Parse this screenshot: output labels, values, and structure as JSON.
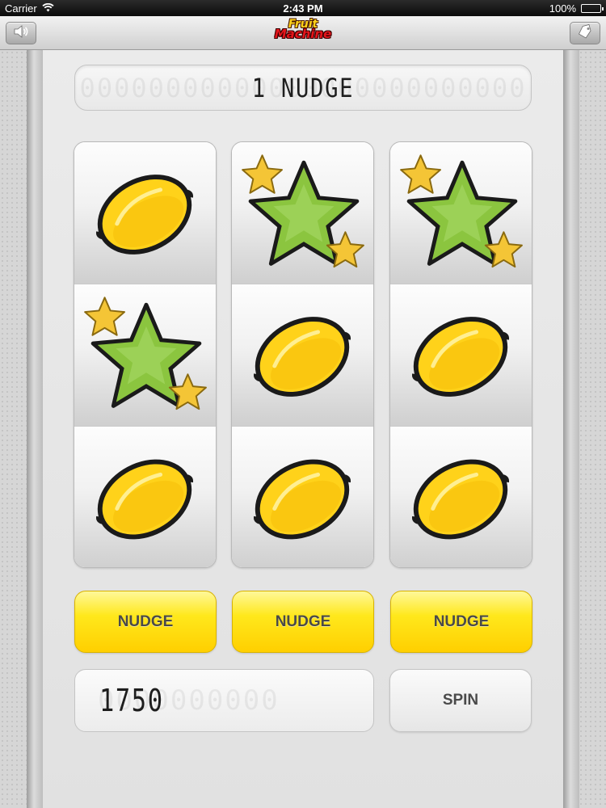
{
  "status_bar": {
    "carrier": "Carrier",
    "time": "2:43 PM",
    "battery": "100%"
  },
  "nav": {
    "logo_line1": "Fruit",
    "logo_line2": "Machine",
    "left_icon": "speaker-icon",
    "right_icon": "tag-icon"
  },
  "display": {
    "message": "1 NUDGE",
    "message_placeholder": "00000000000000000000000000"
  },
  "reels": [
    {
      "symbols": [
        "lemon",
        "star",
        "lemon"
      ]
    },
    {
      "symbols": [
        "star",
        "lemon",
        "lemon"
      ]
    },
    {
      "symbols": [
        "star",
        "lemon",
        "lemon"
      ]
    }
  ],
  "buttons": {
    "nudge_labels": [
      "NUDGE",
      "NUDGE",
      "NUDGE"
    ],
    "spin_label": "SPIN"
  },
  "credits": {
    "value": "1750",
    "placeholder": "0000000000"
  },
  "colors": {
    "lemon": "#ffd21a",
    "star_green": "#8bc53f",
    "star_gold": "#f4c536",
    "nudge_yellow": "#ffe81c"
  }
}
